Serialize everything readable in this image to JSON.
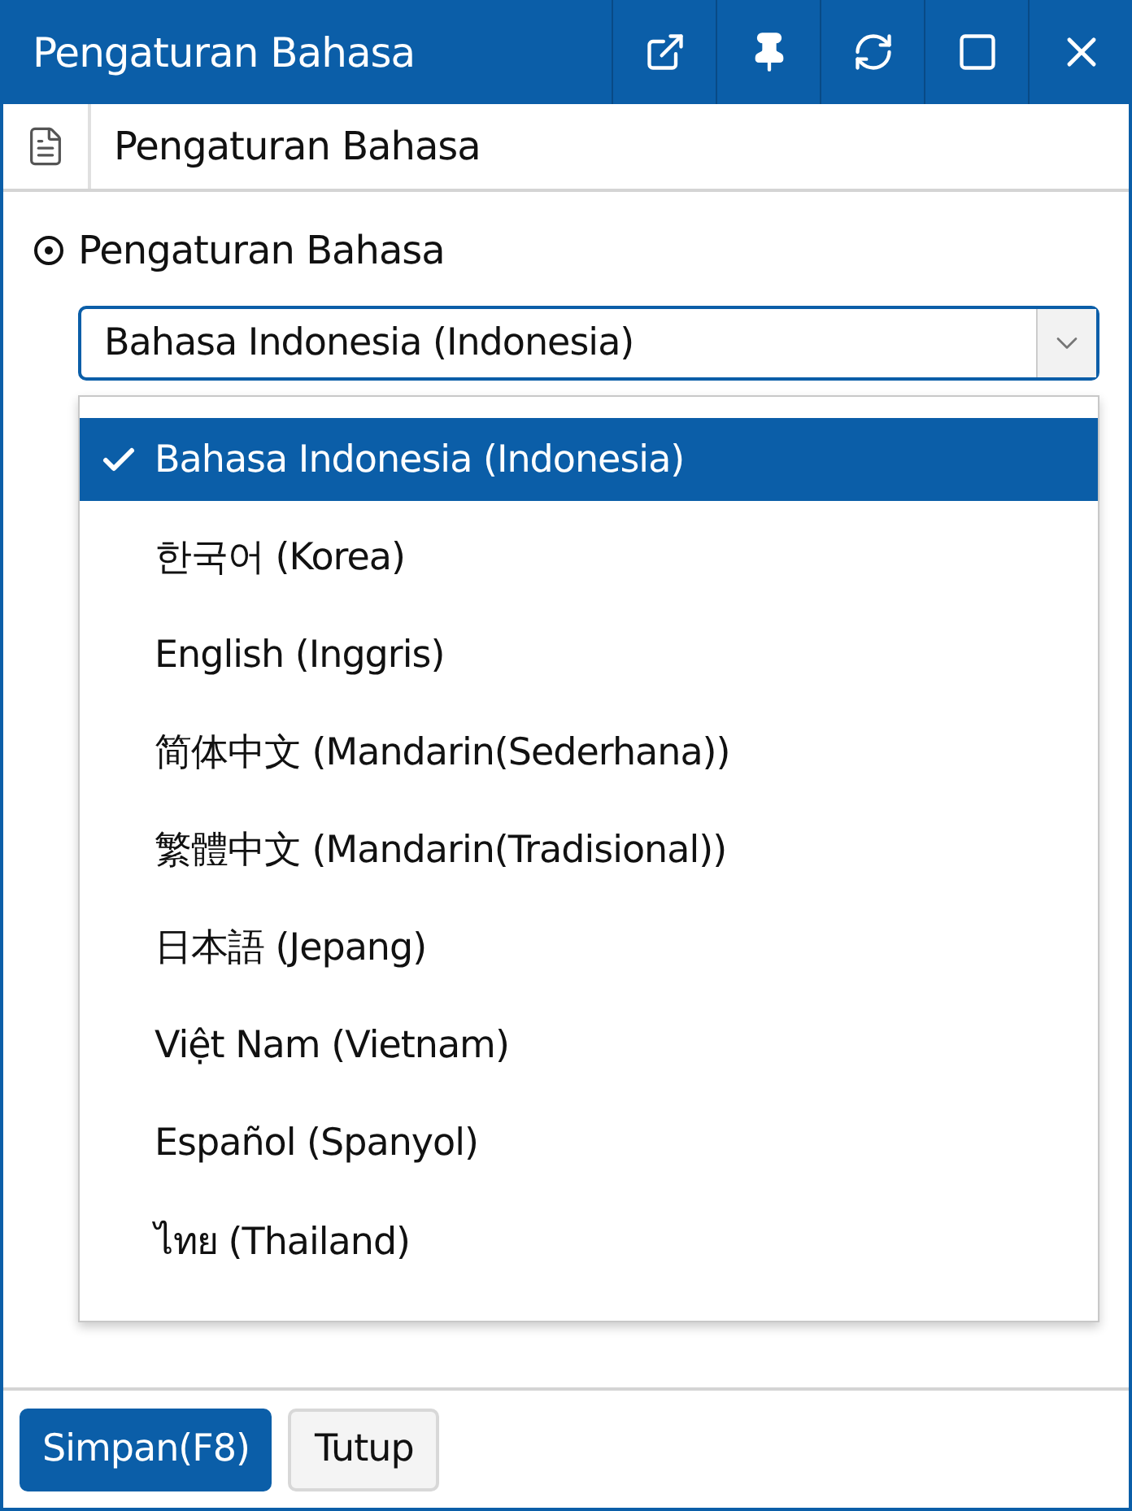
{
  "window": {
    "title": "Pengaturan Bahasa"
  },
  "tab": {
    "label": "Pengaturan Bahasa"
  },
  "section": {
    "label": "Pengaturan Bahasa"
  },
  "language_select": {
    "value": "Bahasa Indonesia (Indonesia)",
    "expanded": true,
    "options": [
      {
        "label": "Bahasa Indonesia (Indonesia)",
        "selected": true
      },
      {
        "label": "한국어 (Korea)",
        "selected": false
      },
      {
        "label": "English (Inggris)",
        "selected": false
      },
      {
        "label": "简体中文 (Mandarin(Sederhana))",
        "selected": false
      },
      {
        "label": "繁體中文 (Mandarin(Tradisional))",
        "selected": false
      },
      {
        "label": "日本語 (Jepang)",
        "selected": false
      },
      {
        "label": "Việt Nam (Vietnam)",
        "selected": false
      },
      {
        "label": "Español (Spanyol)",
        "selected": false
      },
      {
        "label": "ไทย (Thailand)",
        "selected": false
      }
    ]
  },
  "buttons": [
    {
      "label": "Simpan(F8)",
      "kind": "primary"
    },
    {
      "label": "Tutup",
      "kind": "secondary"
    }
  ]
}
